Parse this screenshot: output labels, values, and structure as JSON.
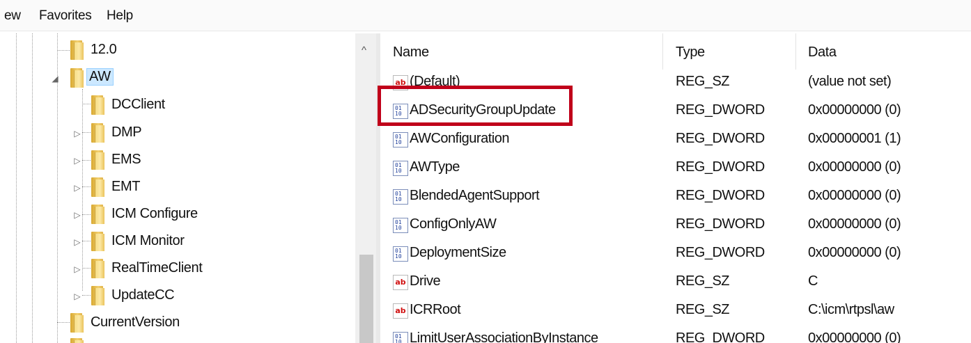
{
  "menu": {
    "items": [
      "ew",
      "Favorites",
      "Help"
    ]
  },
  "tree": {
    "nodes": [
      {
        "label": "12.0",
        "expander": ""
      },
      {
        "label": "AW",
        "expander": "◢"
      },
      {
        "label": "DCClient",
        "expander": ""
      },
      {
        "label": "DMP",
        "expander": "▷"
      },
      {
        "label": "EMS",
        "expander": "▷"
      },
      {
        "label": "EMT",
        "expander": "▷"
      },
      {
        "label": "ICM Configure",
        "expander": "▷"
      },
      {
        "label": "ICM Monitor",
        "expander": "▷"
      },
      {
        "label": "RealTimeClient",
        "expander": "▷"
      },
      {
        "label": "UpdateCC",
        "expander": "▷"
      },
      {
        "label": "CurrentVersion",
        "expander": ""
      }
    ],
    "scroll_up_glyph": "^"
  },
  "list": {
    "headers": {
      "name": "Name",
      "type": "Type",
      "data": "Data"
    },
    "rows": [
      {
        "name": "(Default)",
        "type": "REG_SZ",
        "data": "(value not set)",
        "icon": "string-value-icon"
      },
      {
        "name": "ADSecurityGroupUpdate",
        "type": "REG_DWORD",
        "data": "0x00000000 (0)",
        "icon": "dword-value-icon"
      },
      {
        "name": "AWConfiguration",
        "type": "REG_DWORD",
        "data": "0x00000001 (1)",
        "icon": "dword-value-icon"
      },
      {
        "name": "AWType",
        "type": "REG_DWORD",
        "data": "0x00000000 (0)",
        "icon": "dword-value-icon"
      },
      {
        "name": "BlendedAgentSupport",
        "type": "REG_DWORD",
        "data": "0x00000000 (0)",
        "icon": "dword-value-icon"
      },
      {
        "name": "ConfigOnlyAW",
        "type": "REG_DWORD",
        "data": "0x00000000 (0)",
        "icon": "dword-value-icon"
      },
      {
        "name": "DeploymentSize",
        "type": "REG_DWORD",
        "data": "0x00000000 (0)",
        "icon": "dword-value-icon"
      },
      {
        "name": "Drive",
        "type": "REG_SZ",
        "data": "C",
        "icon": "string-value-icon"
      },
      {
        "name": "ICRRoot",
        "type": "REG_SZ",
        "data": "C:\\icm\\rtpsl\\aw",
        "icon": "string-value-icon"
      },
      {
        "name": "LimitUserAssociationByInstance",
        "type": "REG_DWORD",
        "data": "0x00000000 (0)",
        "icon": "dword-value-icon"
      }
    ]
  },
  "colors": {
    "highlight_box": "#c0001a",
    "selection": "#cce8ff"
  }
}
